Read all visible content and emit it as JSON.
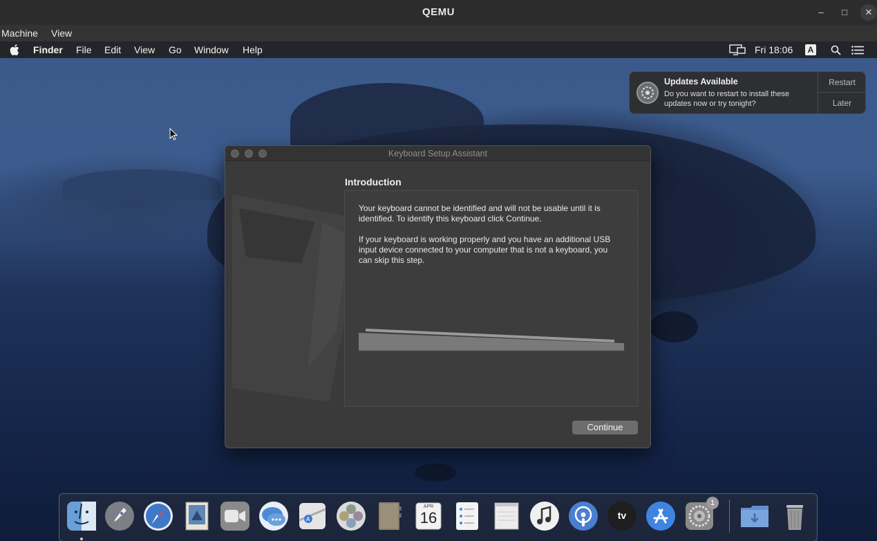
{
  "host": {
    "title": "QEMU",
    "menu": [
      "Machine",
      "View"
    ],
    "buttons": {
      "minimize": "–",
      "maximize": "□",
      "close": "✕"
    }
  },
  "mac_menubar": {
    "app": "Finder",
    "items": [
      "File",
      "Edit",
      "View",
      "Go",
      "Window",
      "Help"
    ],
    "clock": "Fri 18:06",
    "input_badge": "A"
  },
  "notification": {
    "title": "Updates Available",
    "body": "Do you want to restart to install these updates now or try tonight?",
    "actions": [
      "Restart",
      "Later"
    ]
  },
  "dialog": {
    "title": "Keyboard Setup Assistant",
    "heading": "Introduction",
    "paragraph1": "Your keyboard cannot be identified and will not be usable until it is identified. To identify this keyboard click Continue.",
    "paragraph2": "If your keyboard is working properly and you have an additional USB input device connected to your computer that is not a keyboard, you can skip this step.",
    "continue_label": "Continue"
  },
  "dock": {
    "calendar_month": "APR",
    "calendar_day": "16",
    "tv_label": "tv",
    "settings_badge": "1",
    "items": [
      "finder-icon",
      "launchpad-icon",
      "safari-icon",
      "mail-icon",
      "facetime-icon",
      "messages-icon",
      "maps-icon",
      "photos-icon",
      "contacts-icon",
      "calendar-icon",
      "reminders-icon",
      "notes-icon",
      "music-icon",
      "podcasts-icon",
      "tv-icon",
      "app-store-icon",
      "system-preferences-icon",
      "downloads-folder-icon",
      "trash-icon"
    ]
  }
}
